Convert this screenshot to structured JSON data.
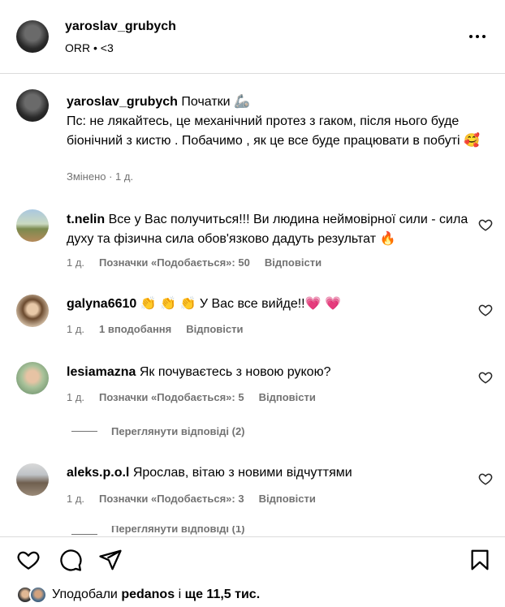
{
  "header": {
    "username": "yaroslav_grubych",
    "subtitle": "ORR • <3",
    "more_icon": "more-horizontal-icon"
  },
  "post": {
    "username": "yaroslav_grubych",
    "text": "Початки 🦾\nПс: не лякайтесь, це механічний протез з гаком, після нього буде біонічний з кистю . Побачимо , як це все буде працювати в побуті 🥰",
    "meta": "Змінено · 1 д."
  },
  "comments": [
    {
      "username": "t.nelin",
      "text": "Все у Вас получиться!!! Ви людина неймовірної сили - сила духу та фізична сила обов'язково дадуть результат 🔥",
      "time": "1 д.",
      "likes": "Позначки «Подобається»: 50",
      "reply": "Відповісти"
    },
    {
      "username": "galyna6610",
      "text": "👏 👏 👏 У Вас все вийде!!💗 💗",
      "time": "1 д.",
      "likes": "1 вподобання",
      "reply": "Відповісти"
    },
    {
      "username": "lesiamazna",
      "text": "Як почуваєтесь з новою рукою?",
      "time": "1 д.",
      "likes": "Позначки «Подобається»: 5",
      "reply": "Відповісти"
    },
    {
      "username": "aleks.p.o.l",
      "text": "Ярослав, вітаю з новими відчуттями",
      "time": "1 д.",
      "likes": "Позначки «Подобається»: 3",
      "reply": "Відповісти"
    }
  ],
  "view_replies": "Переглянути відповіді (2)",
  "view_replies_cut": "Переглянути відповіді (1)",
  "actions": {
    "like_icon": "heart-icon",
    "comment_icon": "comment-icon",
    "share_icon": "send-icon",
    "save_icon": "bookmark-icon"
  },
  "likes_summary": {
    "prefix": "Уподобали",
    "user": "pedanos",
    "middle": "і",
    "count": "ще 11,5 тис."
  }
}
